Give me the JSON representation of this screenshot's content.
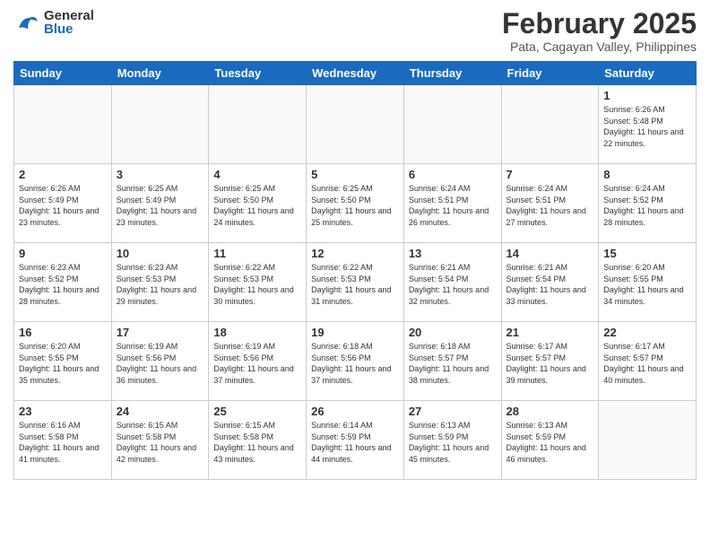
{
  "header": {
    "logo_general": "General",
    "logo_blue": "Blue",
    "month": "February 2025",
    "location": "Pata, Cagayan Valley, Philippines"
  },
  "days_of_week": [
    "Sunday",
    "Monday",
    "Tuesday",
    "Wednesday",
    "Thursday",
    "Friday",
    "Saturday"
  ],
  "weeks": [
    [
      {
        "day": "",
        "empty": true
      },
      {
        "day": "",
        "empty": true
      },
      {
        "day": "",
        "empty": true
      },
      {
        "day": "",
        "empty": true
      },
      {
        "day": "",
        "empty": true
      },
      {
        "day": "",
        "empty": true
      },
      {
        "day": "1",
        "sunrise": "6:26 AM",
        "sunset": "5:48 PM",
        "daylight": "11 hours and 22 minutes."
      }
    ],
    [
      {
        "day": "2",
        "sunrise": "6:26 AM",
        "sunset": "5:49 PM",
        "daylight": "11 hours and 23 minutes."
      },
      {
        "day": "3",
        "sunrise": "6:25 AM",
        "sunset": "5:49 PM",
        "daylight": "11 hours and 23 minutes."
      },
      {
        "day": "4",
        "sunrise": "6:25 AM",
        "sunset": "5:50 PM",
        "daylight": "11 hours and 24 minutes."
      },
      {
        "day": "5",
        "sunrise": "6:25 AM",
        "sunset": "5:50 PM",
        "daylight": "11 hours and 25 minutes."
      },
      {
        "day": "6",
        "sunrise": "6:24 AM",
        "sunset": "5:51 PM",
        "daylight": "11 hours and 26 minutes."
      },
      {
        "day": "7",
        "sunrise": "6:24 AM",
        "sunset": "5:51 PM",
        "daylight": "11 hours and 27 minutes."
      },
      {
        "day": "8",
        "sunrise": "6:24 AM",
        "sunset": "5:52 PM",
        "daylight": "11 hours and 28 minutes."
      }
    ],
    [
      {
        "day": "9",
        "sunrise": "6:23 AM",
        "sunset": "5:52 PM",
        "daylight": "11 hours and 28 minutes."
      },
      {
        "day": "10",
        "sunrise": "6:23 AM",
        "sunset": "5:53 PM",
        "daylight": "11 hours and 29 minutes."
      },
      {
        "day": "11",
        "sunrise": "6:22 AM",
        "sunset": "5:53 PM",
        "daylight": "11 hours and 30 minutes."
      },
      {
        "day": "12",
        "sunrise": "6:22 AM",
        "sunset": "5:53 PM",
        "daylight": "11 hours and 31 minutes."
      },
      {
        "day": "13",
        "sunrise": "6:21 AM",
        "sunset": "5:54 PM",
        "daylight": "11 hours and 32 minutes."
      },
      {
        "day": "14",
        "sunrise": "6:21 AM",
        "sunset": "5:54 PM",
        "daylight": "11 hours and 33 minutes."
      },
      {
        "day": "15",
        "sunrise": "6:20 AM",
        "sunset": "5:55 PM",
        "daylight": "11 hours and 34 minutes."
      }
    ],
    [
      {
        "day": "16",
        "sunrise": "6:20 AM",
        "sunset": "5:55 PM",
        "daylight": "11 hours and 35 minutes."
      },
      {
        "day": "17",
        "sunrise": "6:19 AM",
        "sunset": "5:56 PM",
        "daylight": "11 hours and 36 minutes."
      },
      {
        "day": "18",
        "sunrise": "6:19 AM",
        "sunset": "5:56 PM",
        "daylight": "11 hours and 37 minutes."
      },
      {
        "day": "19",
        "sunrise": "6:18 AM",
        "sunset": "5:56 PM",
        "daylight": "11 hours and 37 minutes."
      },
      {
        "day": "20",
        "sunrise": "6:18 AM",
        "sunset": "5:57 PM",
        "daylight": "11 hours and 38 minutes."
      },
      {
        "day": "21",
        "sunrise": "6:17 AM",
        "sunset": "5:57 PM",
        "daylight": "11 hours and 39 minutes."
      },
      {
        "day": "22",
        "sunrise": "6:17 AM",
        "sunset": "5:57 PM",
        "daylight": "11 hours and 40 minutes."
      }
    ],
    [
      {
        "day": "23",
        "sunrise": "6:16 AM",
        "sunset": "5:58 PM",
        "daylight": "11 hours and 41 minutes."
      },
      {
        "day": "24",
        "sunrise": "6:15 AM",
        "sunset": "5:58 PM",
        "daylight": "11 hours and 42 minutes."
      },
      {
        "day": "25",
        "sunrise": "6:15 AM",
        "sunset": "5:58 PM",
        "daylight": "11 hours and 43 minutes."
      },
      {
        "day": "26",
        "sunrise": "6:14 AM",
        "sunset": "5:59 PM",
        "daylight": "11 hours and 44 minutes."
      },
      {
        "day": "27",
        "sunrise": "6:13 AM",
        "sunset": "5:59 PM",
        "daylight": "11 hours and 45 minutes."
      },
      {
        "day": "28",
        "sunrise": "6:13 AM",
        "sunset": "5:59 PM",
        "daylight": "11 hours and 46 minutes."
      },
      {
        "day": "",
        "empty": true
      }
    ]
  ]
}
